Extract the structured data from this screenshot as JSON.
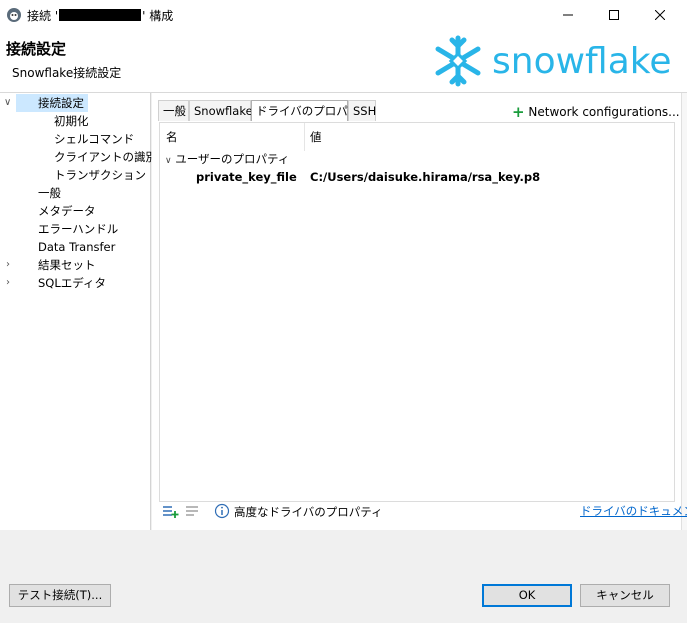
{
  "window": {
    "title_prefix": "接続 '",
    "title_suffix": "' 構成"
  },
  "header": {
    "title": "接続設定",
    "subtitle": "Snowflake接続設定",
    "logo_text": "snowflake",
    "logo_color": "#29b5e8"
  },
  "tree": {
    "items": [
      {
        "label": "接続設定",
        "selected": true,
        "expanded": true
      },
      {
        "label": "初期化"
      },
      {
        "label": "シェルコマンド"
      },
      {
        "label": "クライアントの識別"
      },
      {
        "label": "トランザクション"
      },
      {
        "label": "一般"
      },
      {
        "label": "メタデータ"
      },
      {
        "label": "エラーハンドル"
      },
      {
        "label": "Data Transfer"
      },
      {
        "label": "結果セット",
        "expandable": true
      },
      {
        "label": "SQLエディタ",
        "expandable": true
      }
    ]
  },
  "tabs": [
    {
      "label": "一般"
    },
    {
      "label": "Snowflake"
    },
    {
      "label": "ドライバのプロパティ",
      "active": true
    },
    {
      "label": "SSH"
    }
  ],
  "network_config_label": "Network configurations...",
  "grid": {
    "col_name": "名",
    "col_value": "値",
    "group_label": "ユーザーのプロパティ",
    "prop_key": "private_key_file",
    "prop_value": "C:/Users/daisuke.hirama/rsa_key.p8"
  },
  "bottom": {
    "advanced_label": "高度なドライバのプロパティ",
    "docs_link": "ドライバのドキュメント"
  },
  "buttons": {
    "test": "テスト接続(T)...",
    "ok": "OK",
    "cancel": "キャンセル"
  },
  "colors": {
    "selection": "#cce8ff",
    "link": "#0066cc",
    "accent_green": "#1a9c3c",
    "default_button_border": "#0078d7"
  }
}
